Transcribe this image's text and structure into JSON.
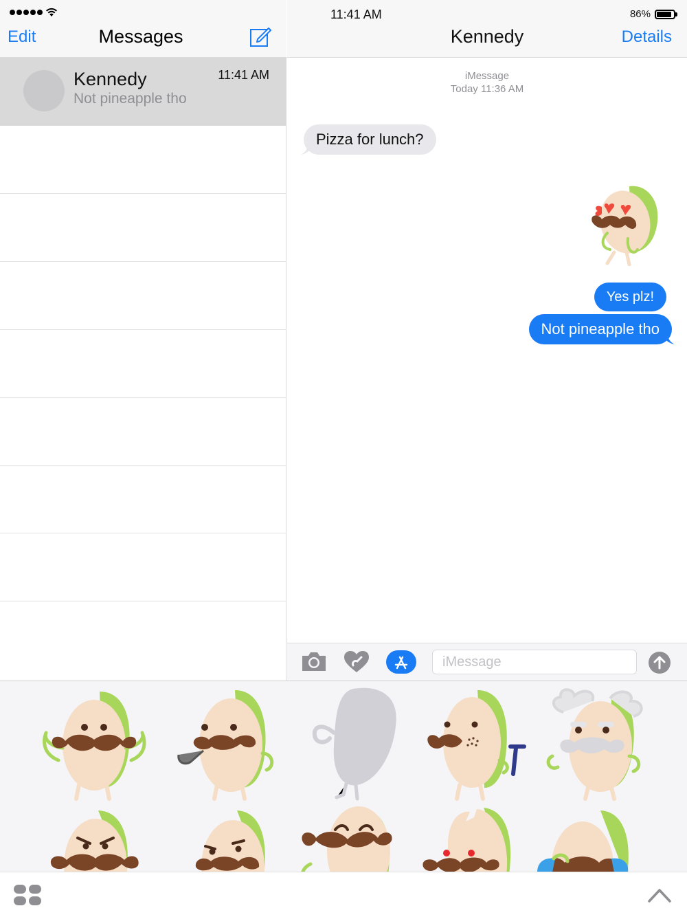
{
  "status_bar": {
    "time": "11:41 AM",
    "battery_percent": "86%",
    "battery_level": 0.86,
    "signal_dots": 5
  },
  "sidebar": {
    "edit_label": "Edit",
    "title": "Messages",
    "compose_icon": "compose-icon",
    "conversations": [
      {
        "name": "Kennedy",
        "preview": "Not pineapple tho",
        "time": "11:41 AM",
        "selected": true
      }
    ]
  },
  "chat": {
    "title": "Kennedy",
    "details_label": "Details",
    "service_label": "iMessage",
    "service_time": "Today 11:36 AM",
    "messages": [
      {
        "direction": "incoming",
        "text": "Pizza for lunch?"
      },
      {
        "direction": "outgoing",
        "type": "sticker",
        "sticker": "pistachio-heart-eyes"
      },
      {
        "direction": "outgoing",
        "text": "Yes plz!"
      },
      {
        "direction": "outgoing",
        "text": "Not pineapple tho"
      }
    ]
  },
  "input_bar": {
    "placeholder": "iMessage",
    "value": "",
    "icons": [
      "camera-icon",
      "digital-touch-icon",
      "app-store-icon",
      "send-icon"
    ]
  },
  "sticker_drawer": {
    "stickers": [
      "pistachio-flexing",
      "pistachio-pipe",
      "pistachio-placeholder",
      "pistachio-razor",
      "pistachio-professor",
      "pistachio-angry",
      "pistachio-suspicious",
      "pistachio-laughing",
      "pistachio-cracked",
      "pistachio-crying"
    ]
  },
  "bottom_bar": {
    "icons": [
      "app-drawer-icon",
      "expand-chevron-icon"
    ]
  },
  "colors": {
    "accent": "#1a7cf5",
    "incoming_bubble": "#e8e8ec",
    "selected_row": "#d9d9d9",
    "pistachio_shell": "#f6ddc6",
    "pistachio_green": "#a8d65a",
    "mustache": "#7a4427"
  }
}
